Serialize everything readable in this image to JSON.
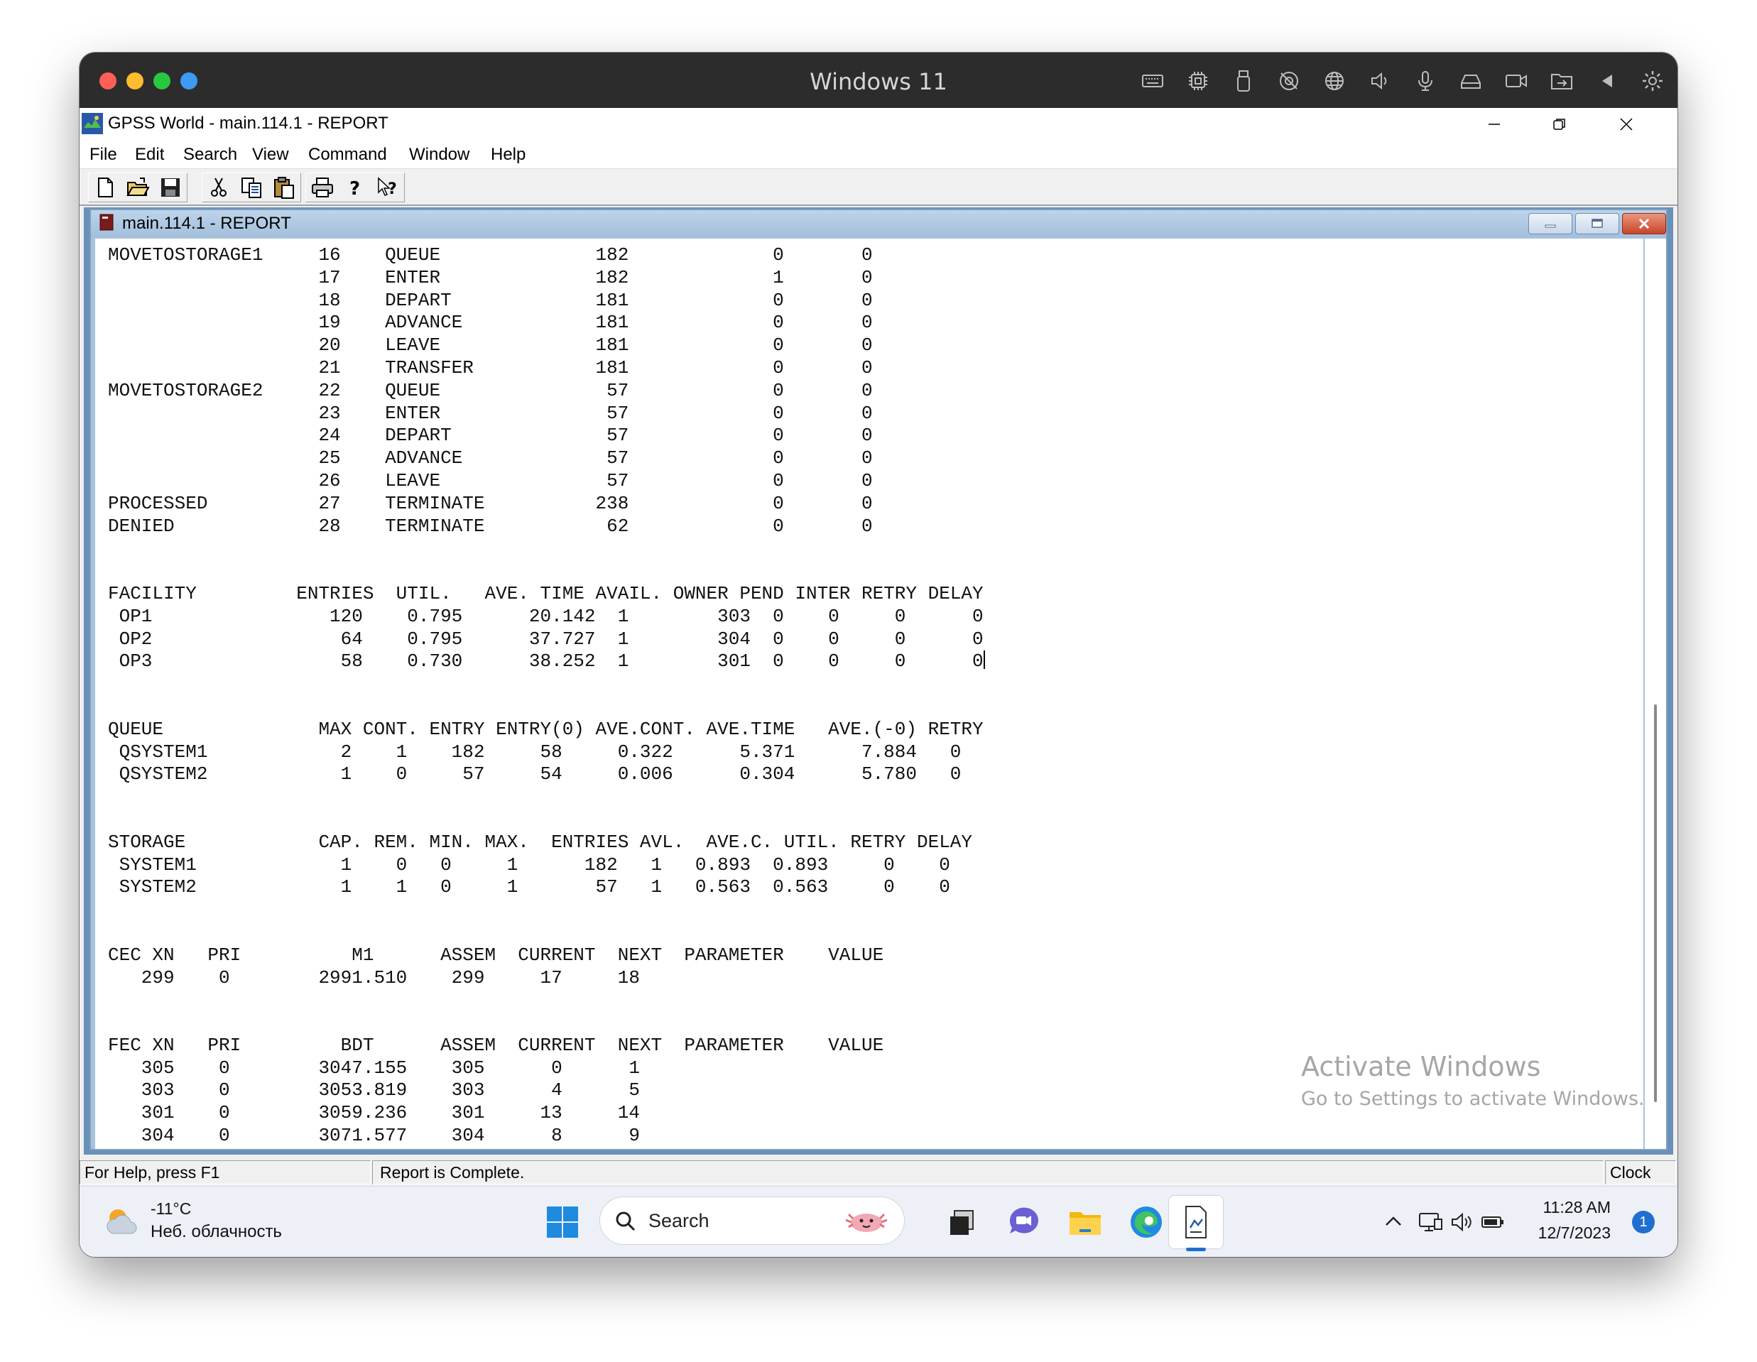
{
  "vm": {
    "title": "Windows 11",
    "icons": [
      "keyboard-icon",
      "cpu-icon",
      "usb-icon",
      "camera-off-icon",
      "globe-icon",
      "speaker-icon",
      "microphone-icon",
      "disk-icon",
      "video-icon",
      "folder-share-icon",
      "back-arrow-icon",
      "settings-gear-icon"
    ]
  },
  "app": {
    "title": "GPSS World - main.114.1  -  REPORT",
    "menu": [
      "File",
      "Edit",
      "Search",
      "View",
      "Command",
      "Window",
      "Help"
    ],
    "toolbar": [
      "new-icon",
      "open-icon",
      "save-icon",
      "cut-icon",
      "copy-icon",
      "paste-icon",
      "print-icon",
      "help-icon",
      "context-help-icon"
    ]
  },
  "child": {
    "title": "main.114.1  -  REPORT"
  },
  "report": {
    "blocks": [
      {
        "label": "MOVETOSTORAGE1",
        "loc": "16",
        "type": "QUEUE",
        "entry": "182",
        "current": "0",
        "retry": "0"
      },
      {
        "label": "",
        "loc": "17",
        "type": "ENTER",
        "entry": "182",
        "current": "1",
        "retry": "0"
      },
      {
        "label": "",
        "loc": "18",
        "type": "DEPART",
        "entry": "181",
        "current": "0",
        "retry": "0"
      },
      {
        "label": "",
        "loc": "19",
        "type": "ADVANCE",
        "entry": "181",
        "current": "0",
        "retry": "0"
      },
      {
        "label": "",
        "loc": "20",
        "type": "LEAVE",
        "entry": "181",
        "current": "0",
        "retry": "0"
      },
      {
        "label": "",
        "loc": "21",
        "type": "TRANSFER",
        "entry": "181",
        "current": "0",
        "retry": "0"
      },
      {
        "label": "MOVETOSTORAGE2",
        "loc": "22",
        "type": "QUEUE",
        "entry": "57",
        "current": "0",
        "retry": "0"
      },
      {
        "label": "",
        "loc": "23",
        "type": "ENTER",
        "entry": "57",
        "current": "0",
        "retry": "0"
      },
      {
        "label": "",
        "loc": "24",
        "type": "DEPART",
        "entry": "57",
        "current": "0",
        "retry": "0"
      },
      {
        "label": "",
        "loc": "25",
        "type": "ADVANCE",
        "entry": "57",
        "current": "0",
        "retry": "0"
      },
      {
        "label": "",
        "loc": "26",
        "type": "LEAVE",
        "entry": "57",
        "current": "0",
        "retry": "0"
      },
      {
        "label": "PROCESSED",
        "loc": "27",
        "type": "TERMINATE",
        "entry": "238",
        "current": "0",
        "retry": "0"
      },
      {
        "label": "DENIED",
        "loc": "28",
        "type": "TERMINATE",
        "entry": "62",
        "current": "0",
        "retry": "0"
      }
    ],
    "facility": {
      "headers": [
        "FACILITY",
        "ENTRIES",
        "UTIL.",
        "AVE. TIME",
        "AVAIL.",
        "OWNER",
        "PEND",
        "INTER",
        "RETRY",
        "DELAY"
      ],
      "rows": [
        [
          "OP1",
          "120",
          "0.795",
          "20.142",
          "1",
          "303",
          "0",
          "0",
          "0",
          "0"
        ],
        [
          "OP2",
          "64",
          "0.795",
          "37.727",
          "1",
          "304",
          "0",
          "0",
          "0",
          "0"
        ],
        [
          "OP3",
          "58",
          "0.730",
          "38.252",
          "1",
          "301",
          "0",
          "0",
          "0",
          "0"
        ]
      ]
    },
    "queue": {
      "headers": [
        "QUEUE",
        "MAX",
        "CONT.",
        "ENTRY",
        "ENTRY(0)",
        "AVE.CONT.",
        "AVE.TIME",
        "AVE.(-0)",
        "RETRY"
      ],
      "rows": [
        [
          "QSYSTEM1",
          "2",
          "1",
          "182",
          "58",
          "0.322",
          "5.371",
          "7.884",
          "0"
        ],
        [
          "QSYSTEM2",
          "1",
          "0",
          "57",
          "54",
          "0.006",
          "0.304",
          "5.780",
          "0"
        ]
      ]
    },
    "storage": {
      "headers": [
        "STORAGE",
        "CAP.",
        "REM.",
        "MIN.",
        "MAX.",
        "ENTRIES",
        "AVL.",
        "AVE.C.",
        "UTIL.",
        "RETRY",
        "DELAY"
      ],
      "rows": [
        [
          "SYSTEM1",
          "1",
          "0",
          "0",
          "1",
          "182",
          "1",
          "0.893",
          "0.893",
          "0",
          "0"
        ],
        [
          "SYSTEM2",
          "1",
          "1",
          "0",
          "1",
          "57",
          "1",
          "0.563",
          "0.563",
          "0",
          "0"
        ]
      ]
    },
    "cec": {
      "headers": [
        "CEC XN",
        "PRI",
        "M1",
        "ASSEM",
        "CURRENT",
        "NEXT",
        "PARAMETER",
        "VALUE"
      ],
      "rows": [
        [
          "299",
          "0",
          "2991.510",
          "299",
          "17",
          "18"
        ]
      ]
    },
    "fec": {
      "headers": [
        "FEC XN",
        "PRI",
        "BDT",
        "ASSEM",
        "CURRENT",
        "NEXT",
        "PARAMETER",
        "VALUE"
      ],
      "rows": [
        [
          "305",
          "0",
          "3047.155",
          "305",
          "0",
          "1"
        ],
        [
          "303",
          "0",
          "3053.819",
          "303",
          "4",
          "5"
        ],
        [
          "301",
          "0",
          "3059.236",
          "301",
          "13",
          "14"
        ],
        [
          "304",
          "0",
          "3071.577",
          "304",
          "8",
          "9"
        ]
      ]
    }
  },
  "watermark": {
    "line1": "Activate Windows",
    "line2": "Go to Settings to activate Windows."
  },
  "status": {
    "help": "For Help, press F1",
    "message": "Report is Complete.",
    "clock": "Clock"
  },
  "taskbar": {
    "temp": "-11°C",
    "weather": "Неб. облачность",
    "search_placeholder": "Search",
    "time": "11:28 AM",
    "date": "12/7/2023",
    "notifications": "1",
    "apps": [
      "windows-start-icon",
      "task-view-icon",
      "teams-chat-icon",
      "file-explorer-icon",
      "edge-icon",
      "gpss-world-icon"
    ]
  }
}
